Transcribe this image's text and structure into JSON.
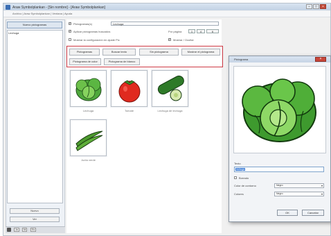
{
  "window": {
    "title": "Araw Symbolplankan - [Sin nombre] - [Araw Symbolplankan]",
    "menu": "Archivo | Araw Symbolplankan | Ventana | Ayuda",
    "controls": {
      "minimize": "–",
      "maximize": "□",
      "close": "×"
    }
  },
  "sidebar": {
    "top_button": "Nuevo pictogramas",
    "list_items": [
      "Lechuga"
    ],
    "buttons": [
      "Nuevo",
      "Ver"
    ],
    "bottom_bar": [
      "Ja",
      "Nl",
      "Es"
    ]
  },
  "options": {
    "row1_label": "Pictogramas(s)",
    "row1_value": "Lechuga",
    "row2_label": "Aplicar pictogramas buscados",
    "row2_side_label": "Por página",
    "row2_numbers": [
      "1",
      "4",
      "6"
    ],
    "row3_label": "Mostrar la configuración en ajuste Pic",
    "row3_side_label": "Mostrar / Ocultar"
  },
  "toolbar": {
    "buttons": [
      "Pictogramas",
      "Buscar texto",
      "Sin pictograma",
      "Mostrar el pictograma",
      "Pictograma de color",
      "Pictograma de blanco"
    ]
  },
  "tiles": [
    {
      "label": "Lechuga",
      "icon": "lettuce-icon"
    },
    {
      "label": "Tomate",
      "icon": "tomato-icon"
    },
    {
      "label": "Lechuga de lechuga",
      "icon": "cucumber-icon"
    },
    {
      "label": "Judía verde",
      "icon": "green-beans-icon"
    }
  ],
  "dialog": {
    "title": "Pictograma",
    "close": "×",
    "name_label": "Texto",
    "name_value": "lechuga",
    "checkbox_label": "Borrado",
    "color_label": "Color de contorno",
    "color_value": "Negro",
    "bg_label": "Colores",
    "bg_value": "Negro",
    "ok_label": "OK",
    "cancel_label": "Cancelar"
  },
  "colors": {
    "accent_highlight": "#cf3a45",
    "title_gradient": "#c3d2e4",
    "selection": "#3a7bd5"
  }
}
